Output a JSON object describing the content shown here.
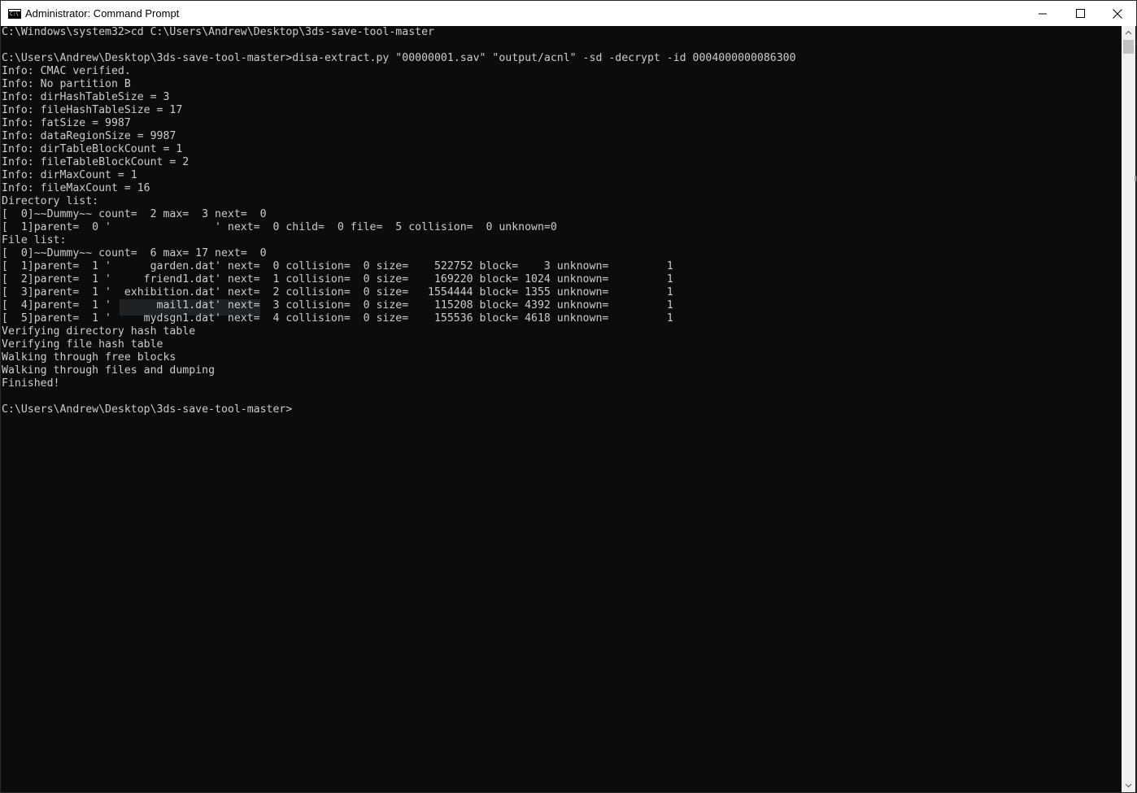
{
  "window": {
    "title": "Administrator: Command Prompt"
  },
  "controls": {
    "minimize_icon": "minimize-icon",
    "maximize_icon": "maximize-icon",
    "close_icon": "close-icon"
  },
  "terminal": {
    "lines": [
      "C:\\Windows\\system32>cd C:\\Users\\Andrew\\Desktop\\3ds-save-tool-master",
      "",
      "C:\\Users\\Andrew\\Desktop\\3ds-save-tool-master>disa-extract.py \"00000001.sav\" \"output/acnl\" -sd -decrypt -id 0004000000086300",
      "Info: CMAC verified.",
      "Info: No partition B",
      "Info: dirHashTableSize = 3",
      "Info: fileHashTableSize = 17",
      "Info: fatSize = 9987",
      "Info: dataRegionSize = 9987",
      "Info: dirTableBlockCount = 1",
      "Info: fileTableBlockCount = 2",
      "Info: dirMaxCount = 1",
      "Info: fileMaxCount = 16",
      "Directory list:",
      "[  0]~~Dummy~~ count=  2 max=  3 next=  0",
      "[  1]parent=  0 '                ' next=  0 child=  0 file=  5 collision=  0 unknown=0",
      "File list:",
      "[  0]~~Dummy~~ count=  6 max= 17 next=  0",
      "[  1]parent=  1 '      garden.dat' next=  0 collision=  0 size=    522752 block=    3 unknown=         1",
      "[  2]parent=  1 '     friend1.dat' next=  1 collision=  0 size=    169220 block= 1024 unknown=         1",
      "[  3]parent=  1 '  exhibition.dat' next=  2 collision=  0 size=   1554444 block= 1355 unknown=         1",
      "[  4]parent=  1 '       mail1.dat' next=  3 collision=  0 size=    115208 block= 4392 unknown=         1",
      "[  5]parent=  1 '     mydsgn1.dat' next=  4 collision=  0 size=    155536 block= 4618 unknown=         1",
      "Verifying directory hash table",
      "Verifying file hash table",
      "Walking through free blocks",
      "Walking through files and dumping",
      "Finished!",
      "",
      "C:\\Users\\Andrew\\Desktop\\3ds-save-tool-master>"
    ]
  },
  "scrollbar": {
    "up_icon": "arrow-up-icon",
    "down_icon": "arrow-down-icon"
  }
}
